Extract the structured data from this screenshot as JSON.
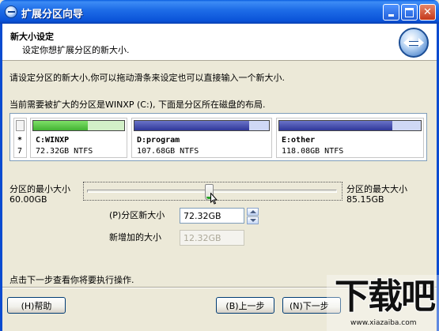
{
  "window": {
    "title": "扩展分区向导"
  },
  "header": {
    "title": "新大小设定",
    "subtitle": "设定你想扩展分区的新大小."
  },
  "instructions": {
    "line1": "请设定分区的新大小,你可以拖动滑条来设定也可以直接输入一个新大小.",
    "line2": "当前需要被扩大的分区是WINXP (C:), 下面是分区所在磁盘的布局."
  },
  "disk_layout": {
    "partitions": [
      {
        "name": "*",
        "size": "7"
      },
      {
        "name": "C:WINXP",
        "size": "72.32GB NTFS"
      },
      {
        "name": "D:program",
        "size": "107.68GB NTFS"
      },
      {
        "name": "E:other",
        "size": "118.08GB NTFS"
      }
    ]
  },
  "slider": {
    "min_label": "分区的最小大小",
    "min_value": "60.00GB",
    "max_label": "分区的最大大小",
    "max_value": "85.15GB",
    "position_fraction": 0.49
  },
  "fields": {
    "new_size_label": "(P)分区新大小",
    "new_size_value": "72.32GB",
    "added_size_label": "新增加的大小",
    "added_size_value": "12.32GB"
  },
  "footer": {
    "note": "点击下一步查看你将要执行操作.",
    "help_button": "(H)帮助",
    "back_button": "(B)上一步",
    "next_button": "(N)下一步"
  },
  "watermark": {
    "logo": "下载吧",
    "url": "www.xiazaiba.com"
  }
}
